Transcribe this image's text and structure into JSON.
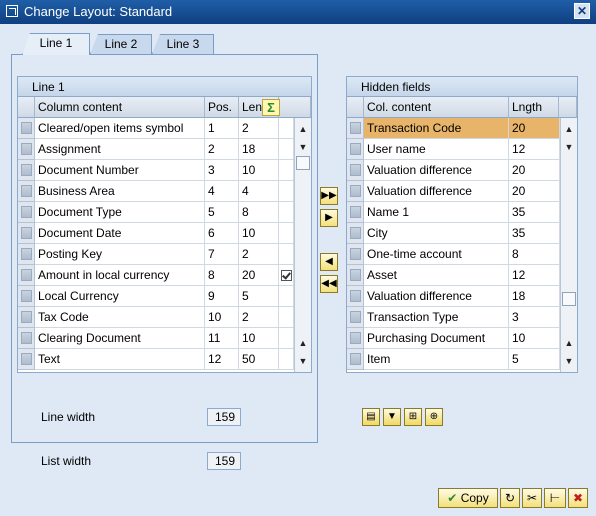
{
  "window": {
    "title": "Change Layout: Standard",
    "close_label": "✕"
  },
  "tabs": [
    {
      "label": "Line 1",
      "active": true
    },
    {
      "label": "Line 2",
      "active": false
    },
    {
      "label": "Line 3",
      "active": false
    }
  ],
  "left_grid": {
    "caption": "Line 1",
    "headers": {
      "content": "Column content",
      "pos": "Pos.",
      "len": "Len...",
      "sum_icon": "sigma-icon"
    },
    "rows": [
      {
        "content": "Cleared/open items symbol",
        "pos": "1",
        "len": "2",
        "sum": false
      },
      {
        "content": "Assignment",
        "pos": "2",
        "len": "18",
        "sum": false
      },
      {
        "content": "Document Number",
        "pos": "3",
        "len": "10",
        "sum": false
      },
      {
        "content": "Business Area",
        "pos": "4",
        "len": "4",
        "sum": false
      },
      {
        "content": "Document Type",
        "pos": "5",
        "len": "8",
        "sum": false
      },
      {
        "content": "Document Date",
        "pos": "6",
        "len": "10",
        "sum": false
      },
      {
        "content": "Posting Key",
        "pos": "7",
        "len": "2",
        "sum": false
      },
      {
        "content": "Amount in local currency",
        "pos": "8",
        "len": "20",
        "sum": true
      },
      {
        "content": "Local Currency",
        "pos": "9",
        "len": "5",
        "sum": false
      },
      {
        "content": "Tax Code",
        "pos": "10",
        "len": "2",
        "sum": false
      },
      {
        "content": "Clearing Document",
        "pos": "11",
        "len": "10",
        "sum": false
      },
      {
        "content": "Text",
        "pos": "12",
        "len": "50",
        "sum": false
      }
    ]
  },
  "right_grid": {
    "caption": "Hidden fields",
    "headers": {
      "content": "Col. content",
      "len": "Lngth"
    },
    "rows": [
      {
        "content": "Transaction Code",
        "len": "20",
        "selected": true
      },
      {
        "content": "User name",
        "len": "12"
      },
      {
        "content": "Valuation difference",
        "len": "20"
      },
      {
        "content": "Valuation difference",
        "len": "20"
      },
      {
        "content": "Name 1",
        "len": "35"
      },
      {
        "content": "City",
        "len": "35"
      },
      {
        "content": "One-time account",
        "len": "8"
      },
      {
        "content": "Asset",
        "len": "12"
      },
      {
        "content": "Valuation difference",
        "len": "18"
      },
      {
        "content": "Transaction Type",
        "len": "3"
      },
      {
        "content": "Purchasing Document",
        "len": "10"
      },
      {
        "content": "Item",
        "len": "5"
      }
    ]
  },
  "move_buttons": [
    {
      "name": "move-all-right-button",
      "icon": "double-arrow-right-icon",
      "glyph": "▶▶"
    },
    {
      "name": "move-right-button",
      "icon": "arrow-right-icon",
      "glyph": "▶"
    },
    {
      "name": "move-left-button",
      "icon": "arrow-left-icon",
      "glyph": "◀"
    },
    {
      "name": "move-all-left-button",
      "icon": "double-arrow-left-icon",
      "glyph": "◀◀"
    }
  ],
  "line_width": {
    "label": "Line width",
    "value": "159"
  },
  "list_width": {
    "label": "List width",
    "value": "159"
  },
  "footer": {
    "copy_label": "Copy"
  },
  "colors": {
    "selected_row": "#e8b46a",
    "accent": "#0f3f80"
  }
}
